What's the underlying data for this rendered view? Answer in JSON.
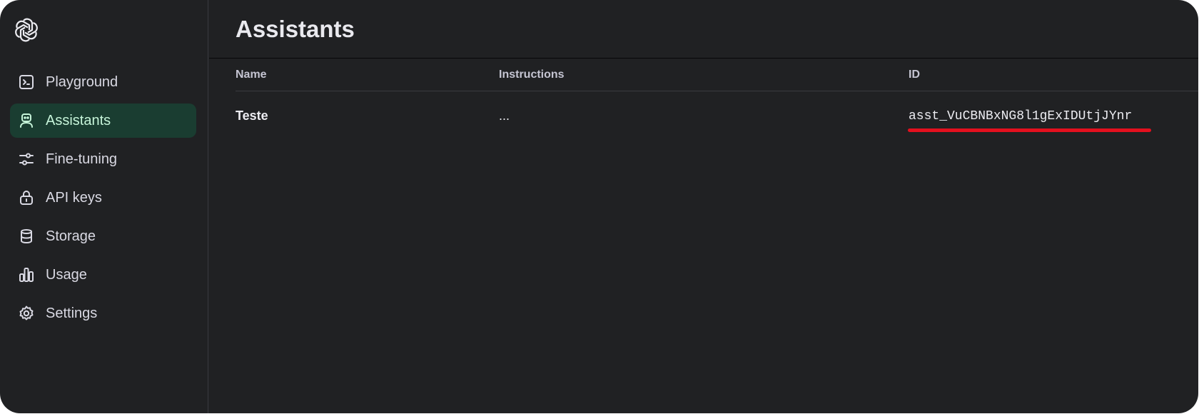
{
  "sidebar": {
    "logo_icon": "openai-logo-icon",
    "items": [
      {
        "label": "Playground",
        "icon": "terminal-icon",
        "active": false
      },
      {
        "label": "Assistants",
        "icon": "robot-icon",
        "active": true
      },
      {
        "label": "Fine-tuning",
        "icon": "sliders-icon",
        "active": false
      },
      {
        "label": "API keys",
        "icon": "lock-icon",
        "active": false
      },
      {
        "label": "Storage",
        "icon": "database-icon",
        "active": false
      },
      {
        "label": "Usage",
        "icon": "bar-chart-icon",
        "active": false
      },
      {
        "label": "Settings",
        "icon": "gear-icon",
        "active": false
      }
    ]
  },
  "header": {
    "title": "Assistants"
  },
  "table": {
    "columns": [
      "Name",
      "Instructions",
      "ID"
    ],
    "rows": [
      {
        "name": "Teste",
        "instructions": "...",
        "id": "asst_VuCBNBxNG8l1gExIDUtjJYnr"
      }
    ]
  },
  "colors": {
    "background": "#202123",
    "active_item_bg": "#1a3d31",
    "highlight_underline": "#e3101e"
  }
}
